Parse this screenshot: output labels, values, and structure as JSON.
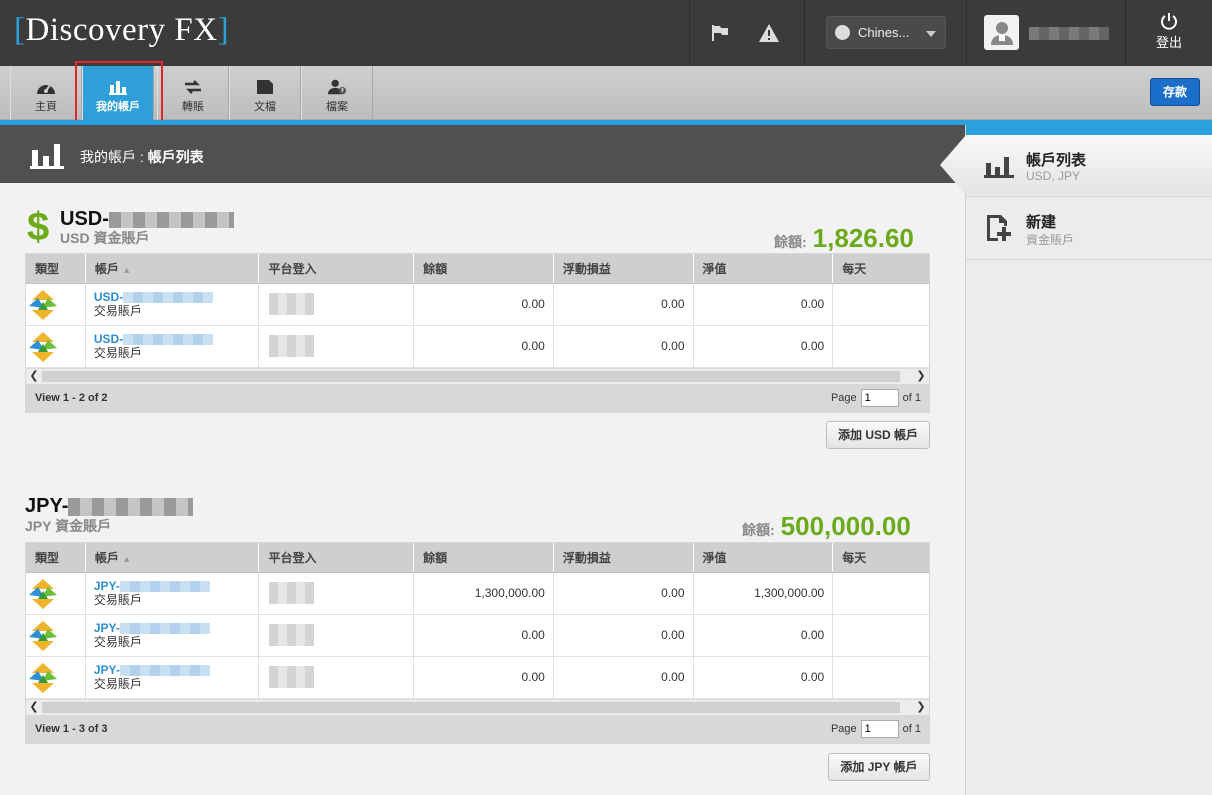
{
  "brand": {
    "logo_text": "Discovery FX",
    "bracket_left": "[",
    "bracket_right": "]"
  },
  "topbar": {
    "flag_icon": "flag-icon",
    "alert_icon": "warning-icon",
    "language": "Chines...",
    "logout_label": "登出"
  },
  "nav": {
    "items": [
      {
        "label": "主頁",
        "icon": "dashboard-icon"
      },
      {
        "label": "我的帳戶",
        "icon": "bar-chart-icon",
        "active": true
      },
      {
        "label": "轉賬",
        "icon": "transfer-icon"
      },
      {
        "label": "文檔",
        "icon": "folder-icon"
      },
      {
        "label": "檔案",
        "icon": "user-profile-icon"
      }
    ],
    "deposit_label": "存款"
  },
  "page_header": {
    "prefix": "我的帳戶 : ",
    "title": "帳戶列表"
  },
  "columns": [
    "類型",
    "帳戶",
    "平台登入",
    "餘額",
    "浮動損益",
    "淨值",
    "每天"
  ],
  "usd": {
    "title": "USD-",
    "subtitle": "USD 資金賬戶",
    "balance_label": "餘額:",
    "balance_value": "1,826.60",
    "rows": [
      {
        "acc_prefix": "USD-",
        "type": "交易賬戶",
        "balance": "0.00",
        "pl": "0.00",
        "equity": "0.00",
        "daily": ""
      },
      {
        "acc_prefix": "USD-",
        "type": "交易賬戶",
        "balance": "0.00",
        "pl": "0.00",
        "equity": "0.00",
        "daily": ""
      }
    ],
    "view_text": "View 1 - 2 of 2",
    "page_label": "Page",
    "page_value": "1",
    "of_label": "of 1",
    "add_button": "添加 USD 帳戶"
  },
  "jpy": {
    "title": "JPY-",
    "subtitle": "JPY 資金賬戶",
    "balance_label": "餘額:",
    "balance_value": "500,000.00",
    "rows": [
      {
        "acc_prefix": "JPY-",
        "type": "交易賬戶",
        "balance": "1,300,000.00",
        "pl": "0.00",
        "equity": "1,300,000.00",
        "daily": ""
      },
      {
        "acc_prefix": "JPY-",
        "type": "交易賬戶",
        "balance": "0.00",
        "pl": "0.00",
        "equity": "0.00",
        "daily": ""
      },
      {
        "acc_prefix": "JPY-",
        "type": "交易賬戶",
        "balance": "0.00",
        "pl": "0.00",
        "equity": "0.00",
        "daily": ""
      }
    ],
    "view_text": "View 1 - 3 of 3",
    "page_label": "Page",
    "page_value": "1",
    "of_label": "of 1",
    "add_button": "添加 JPY 帳戶"
  },
  "sidebar": {
    "items": [
      {
        "title": "帳戶列表",
        "subtitle": "USD, JPY",
        "icon": "bar-chart-icon",
        "active": true
      },
      {
        "title": "新建",
        "subtitle": "資金賬戶",
        "icon": "add-document-icon"
      }
    ]
  },
  "colors": {
    "accent": "#2e9fd9",
    "balance_green": "#6aaa1c",
    "deposit_blue": "#1b6fc9",
    "topbar": "#3b3b3b"
  }
}
